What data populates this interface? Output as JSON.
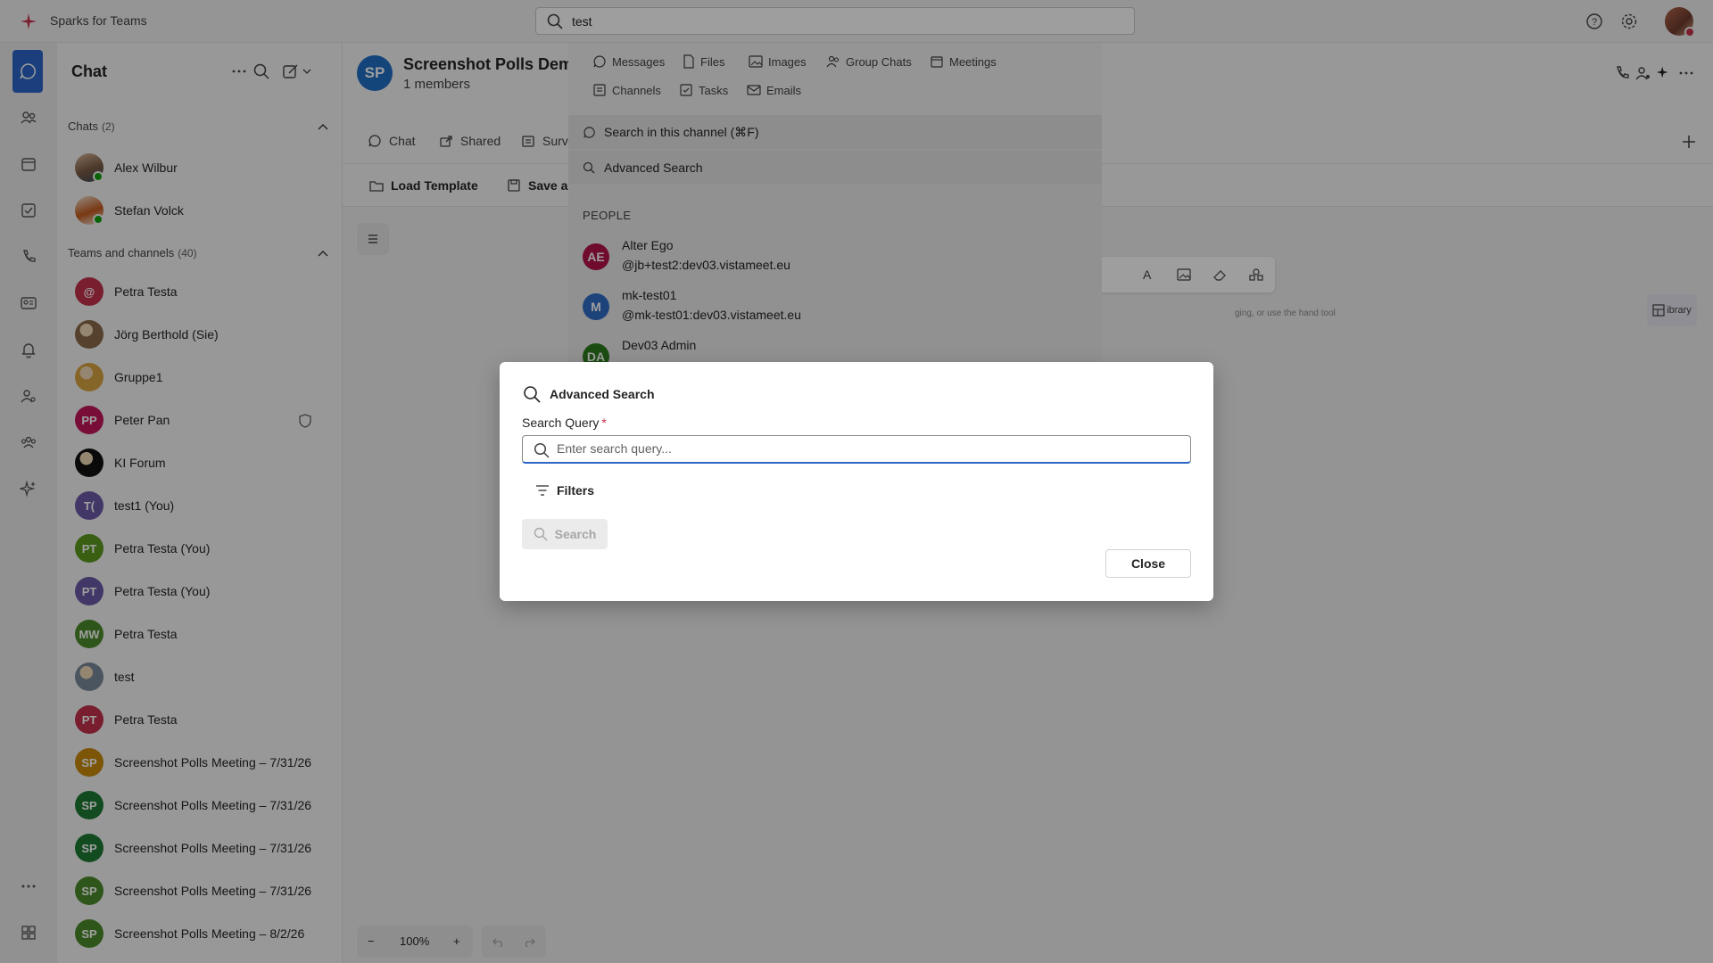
{
  "app": {
    "title": "Sparks for Teams",
    "brand_color": "#c4314b"
  },
  "global_search": {
    "value": "test"
  },
  "chat_list": {
    "title": "Chat",
    "chats_section": {
      "label": "Chats",
      "count": "(2)"
    },
    "chats": [
      {
        "name": "Alex Wilbur"
      },
      {
        "name": "Stefan Volck"
      }
    ],
    "teams_section": {
      "label": "Teams and channels",
      "count": "(40)"
    },
    "teams": [
      {
        "name": "Petra Testa",
        "initials": "@",
        "color": "#c4314b"
      },
      {
        "name": "Jörg Berthold (Sie)",
        "initials": "",
        "color": "#8a6a4a"
      },
      {
        "name": "Gruppe1",
        "initials": "",
        "color": "#d9a441"
      },
      {
        "name": "Peter Pan",
        "initials": "PP",
        "color": "#c2185b"
      },
      {
        "name": "KI Forum",
        "initials": "",
        "color": "#111111"
      },
      {
        "name": "test1 (You)",
        "initials": "T(",
        "color": "#6b5aa6"
      },
      {
        "name": "Petra Testa (You)",
        "initials": "PT",
        "color": "#5b9a1e"
      },
      {
        "name": "Petra Testa (You)",
        "initials": "PT",
        "color": "#6b5aa6"
      },
      {
        "name": "Petra Testa",
        "initials": "MW",
        "color": "#4d8b2a"
      },
      {
        "name": "test",
        "initials": "",
        "color": "#7a8a9a"
      },
      {
        "name": "Petra Testa",
        "initials": "PT",
        "color": "#c4314b"
      },
      {
        "name": "Screenshot Polls Meeting – 7/31/26",
        "initials": "SP",
        "color": "#c98a0c"
      },
      {
        "name": "Screenshot Polls Meeting – 7/31/26",
        "initials": "SP",
        "color": "#1e7a33"
      },
      {
        "name": "Screenshot Polls Meeting – 7/31/26",
        "initials": "SP",
        "color": "#1e7a33"
      },
      {
        "name": "Screenshot Polls Meeting – 7/31/26",
        "initials": "SP",
        "color": "#4d8b2a"
      },
      {
        "name": "Screenshot Polls Meeting – 8/2/26",
        "initials": "SP",
        "color": "#4d8b2a"
      }
    ]
  },
  "channel": {
    "avatar_initials": "SP",
    "title": "Screenshot Polls Demo",
    "subtitle": "1 members",
    "tabs": [
      {
        "label": "Chat"
      },
      {
        "label": "Shared"
      },
      {
        "label": "Surv"
      }
    ],
    "toolbar": {
      "load_template": "Load Template",
      "save_as": "Save as"
    },
    "hint": "ging, or use the hand tool",
    "library": "ibrary",
    "zoom": "100%"
  },
  "search_dropdown": {
    "chips": [
      {
        "label": "Messages"
      },
      {
        "label": "Files"
      },
      {
        "label": "Images"
      },
      {
        "label": "Group Chats"
      },
      {
        "label": "Meetings"
      },
      {
        "label": "Channels"
      },
      {
        "label": "Tasks"
      },
      {
        "label": "Emails"
      }
    ],
    "search_in_channel": "Search in this channel (⌘F)",
    "advanced_search": "Advanced Search",
    "people_header": "PEOPLE",
    "people": [
      {
        "initials": "AE",
        "name": "Alter Ego",
        "handle": "@jb+test2:dev03.vistameet.eu",
        "color": "#b3134a"
      },
      {
        "initials": "M",
        "name": "mk-test01",
        "handle": "@mk-test01:dev03.vistameet.eu",
        "color": "#2f6fc5"
      },
      {
        "initials": "DA",
        "name": "Dev03 Admin",
        "handle": "",
        "color": "#2d7d1e"
      }
    ]
  },
  "dialog": {
    "title": "Advanced Search",
    "query_label": "Search Query",
    "required_mark": "*",
    "placeholder": "Enter search query...",
    "filters_label": "Filters",
    "search_label": "Search",
    "close_label": "Close"
  }
}
